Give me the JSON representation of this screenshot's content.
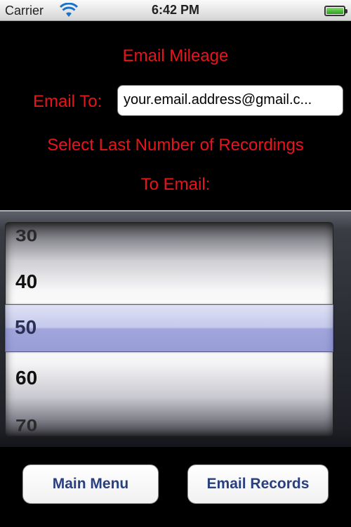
{
  "status_bar": {
    "carrier": "Carrier",
    "time": "6:42 PM",
    "wifi_icon": "wifi-icon",
    "battery_icon": "battery-full-icon"
  },
  "screen": {
    "title": "Email Mileage",
    "email_to_label": "Email To:",
    "email_value": "your.email.address@gmail.c...",
    "select_label_line1": "Select Last Number of Recordings",
    "select_label_line2": "To Email:"
  },
  "picker": {
    "options": [
      "30",
      "40",
      "50",
      "60",
      "70"
    ],
    "selected": "50"
  },
  "buttons": {
    "main_menu": "Main Menu",
    "email_records": "Email Records"
  },
  "colors": {
    "label_red": "#e8141c",
    "button_text": "#2a3f7f",
    "background": "#000000"
  }
}
